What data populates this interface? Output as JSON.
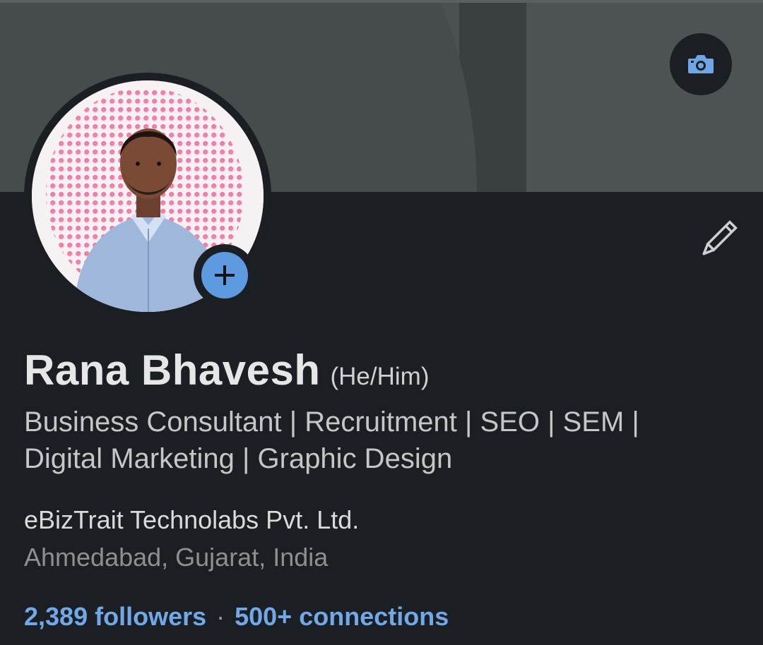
{
  "profile": {
    "name": "Rana Bhavesh",
    "pronouns": "(He/Him)",
    "headline_line1": "Business Consultant | Recruitment | SEO | SEM |",
    "headline_line2": "Digital Marketing | Graphic Design",
    "company": "eBizTrait Technolabs Pvt. Ltd.",
    "location": "Ahmedabad, Gujarat, India",
    "followers": "2,389 followers",
    "separator": "·",
    "connections": "500+ connections"
  },
  "icons": {
    "cover_camera": "camera-icon",
    "add_photo": "plus-icon",
    "edit": "pencil-icon"
  },
  "colors": {
    "background": "#1b1f23",
    "accent": "#5d9ae0",
    "link": "#71a8e8",
    "cover": "#4a5150"
  }
}
